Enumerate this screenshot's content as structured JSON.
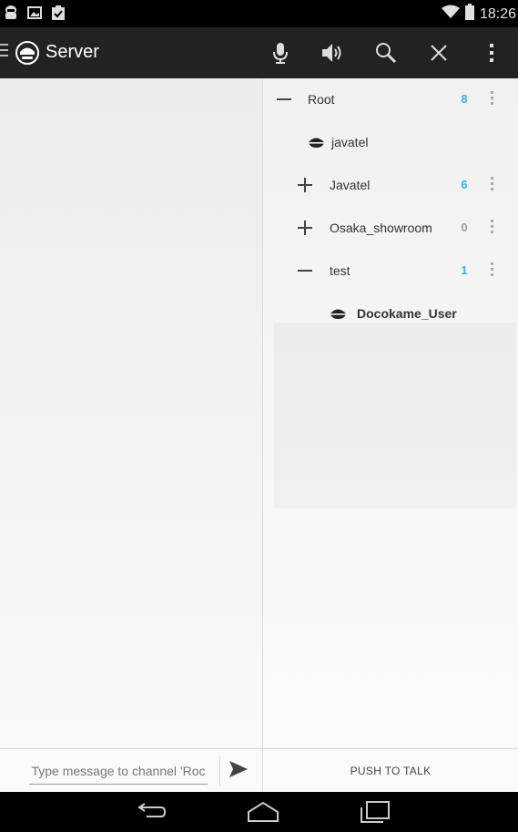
{
  "status_bar": {
    "time": "18:26",
    "icons": [
      "app-notification-icon",
      "image-icon",
      "clipboard-check-icon",
      "wifi-icon",
      "battery-icon"
    ]
  },
  "action_bar": {
    "title": "Server",
    "actions": [
      "microphone-icon",
      "speaker-icon",
      "search-icon",
      "close-icon",
      "overflow-menu-icon"
    ]
  },
  "chat": {
    "input_placeholder": "Type message to channel 'Roc"
  },
  "channels": {
    "rows": [
      {
        "type": "channel",
        "label": "Root",
        "count": "8",
        "expanded": true
      },
      {
        "type": "user",
        "label": "javatel"
      },
      {
        "type": "channel",
        "label": "Javatel",
        "count": "6",
        "expanded": false
      },
      {
        "type": "channel",
        "label": "Osaka_showroom",
        "count": "0",
        "expanded": false
      },
      {
        "type": "channel",
        "label": "test",
        "count": "1",
        "expanded": true
      },
      {
        "type": "user",
        "label": "Docokame_User"
      }
    ]
  },
  "push_to_talk": {
    "label": "PUSH TO TALK"
  },
  "colors": {
    "count_active": "#33b5e5",
    "count_zero": "#9e9e9e",
    "action_bar": "#222222"
  }
}
